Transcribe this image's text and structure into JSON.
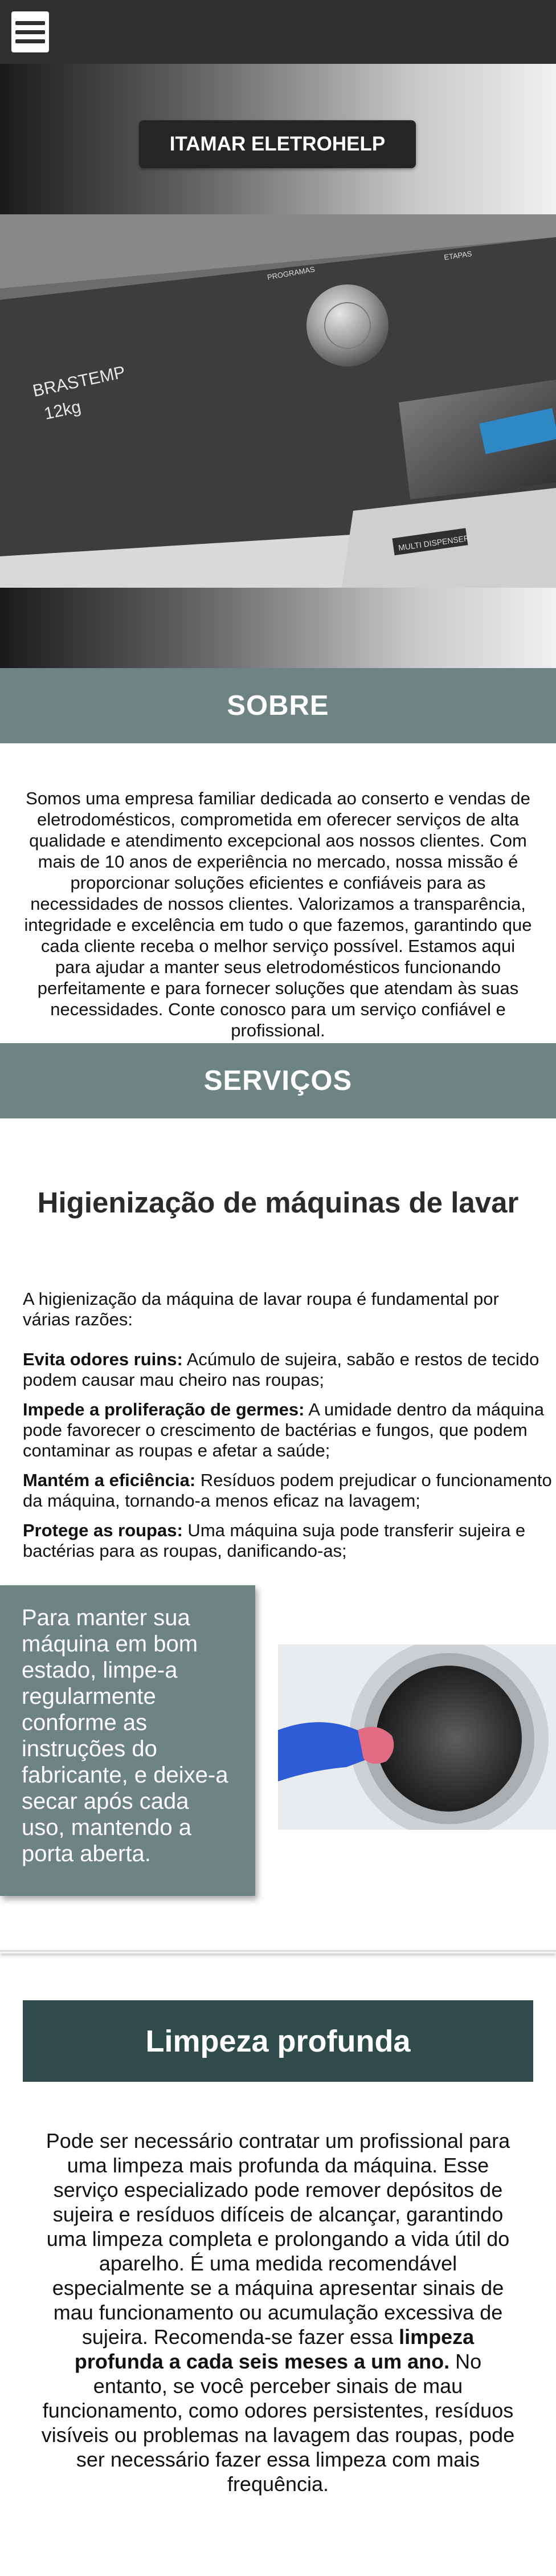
{
  "header": {
    "menu_icon": "hamburger-menu-icon"
  },
  "hero": {
    "brand_button": "ITAMAR ELETROHELP",
    "panel": {
      "brand": "BRASTEMP",
      "capacity": "12kg",
      "programs_label": "PROGRAMAS",
      "options_label": "ETAPAS",
      "dispenser_label": "MULTI DISPENSER"
    }
  },
  "about": {
    "heading": "SOBRE",
    "text": "Somos uma empresa familiar dedicada ao conserto e vendas de eletrodomésticos, comprometida em oferecer serviços de alta qualidade e atendimento excepcional aos nossos clientes. Com mais de 10 anos de experiência no mercado, nossa missão é proporcionar soluções eficientes e confiáveis para as necessidades de nossos clientes. Valorizamos a transparência, integridade e excelência em tudo o que fazemos, garantindo que cada cliente receba o melhor serviço possível. Estamos aqui para ajudar a manter seus eletrodomésticos funcionando perfeitamente e para fornecer soluções que atendam às suas necessidades. Conte conosco para um serviço confiável e profissional."
  },
  "services": {
    "heading": "SERVIÇOS",
    "title": "Higienização de máquinas de lavar",
    "intro": "A higienização da máquina de lavar roupa é fundamental por várias razões:",
    "reasons": [
      {
        "label": "Evita odores ruins:",
        "text": " Acúmulo de sujeira, sabão e restos de tecido podem causar mau cheiro nas roupas;"
      },
      {
        "label": "Impede a proliferação de germes:",
        "text": " A umidade dentro da máquina pode favorecer o crescimento de bactérias e fungos, que podem contaminar as roupas e afetar a saúde;"
      },
      {
        "label": "Mantém a eficiência:",
        "text": " Resíduos podem prejudicar o funcionamento da máquina, tornando-a menos eficaz na lavagem;"
      },
      {
        "label": "Protege as roupas:",
        "text": " Uma máquina suja pode transferir sujeira e bactérias para as roupas, danificando-as;"
      }
    ],
    "tip": "Para manter sua máquina em bom estado, limpe-a regularmente conforme as instruções do fabricante, e deixe-a secar após cada uso, mantendo a porta aberta."
  },
  "deep_clean": {
    "heading": "Limpeza profunda",
    "text_before": "Pode ser necessário contratar um profissional para uma limpeza mais profunda da máquina. Esse serviço especializado pode remover depósitos de sujeira e resíduos difíceis de alcançar, garantindo uma limpeza completa e prolongando a vida útil do aparelho. É uma medida recomendável especialmente se a máquina apresentar sinais de mau funcionamento ou acumulação excessiva de sujeira. Recomenda-se fazer essa ",
    "text_bold": "limpeza profunda a cada seis meses a um ano.",
    "text_after": " No entanto, se você perceber sinais de mau funcionamento, como odores persistentes, resíduos visíveis ou problemas na lavagem das roupas, pode ser necessário fazer essa limpeza com mais frequência."
  }
}
